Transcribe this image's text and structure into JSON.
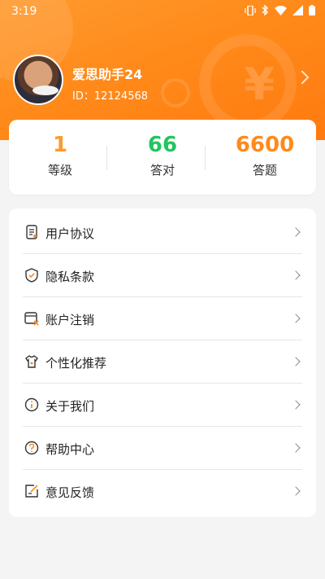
{
  "statusbar": {
    "time": "3:19"
  },
  "colors": {
    "accent": "#ff8a1a",
    "green": "#22c55e",
    "orange_num": "#ff9a2e"
  },
  "profile": {
    "name": "爱思助手24",
    "id_text": "ID：12124568"
  },
  "stats": [
    {
      "value": "1",
      "label": "等级",
      "color": "#ff9a2e"
    },
    {
      "value": "66",
      "label": "答对",
      "color": "#22c55e"
    },
    {
      "value": "6600",
      "label": "答题",
      "color": "#ff8a1a"
    }
  ],
  "menu": [
    {
      "label": "用户协议",
      "icon": "document-icon"
    },
    {
      "label": "隐私条款",
      "icon": "shield-check-icon"
    },
    {
      "label": "账户注销",
      "icon": "account-cancel-icon"
    },
    {
      "label": "个性化推荐",
      "icon": "tshirt-icon"
    },
    {
      "label": "关于我们",
      "icon": "info-icon"
    },
    {
      "label": "帮助中心",
      "icon": "help-icon"
    },
    {
      "label": "意见反馈",
      "icon": "feedback-icon"
    }
  ]
}
